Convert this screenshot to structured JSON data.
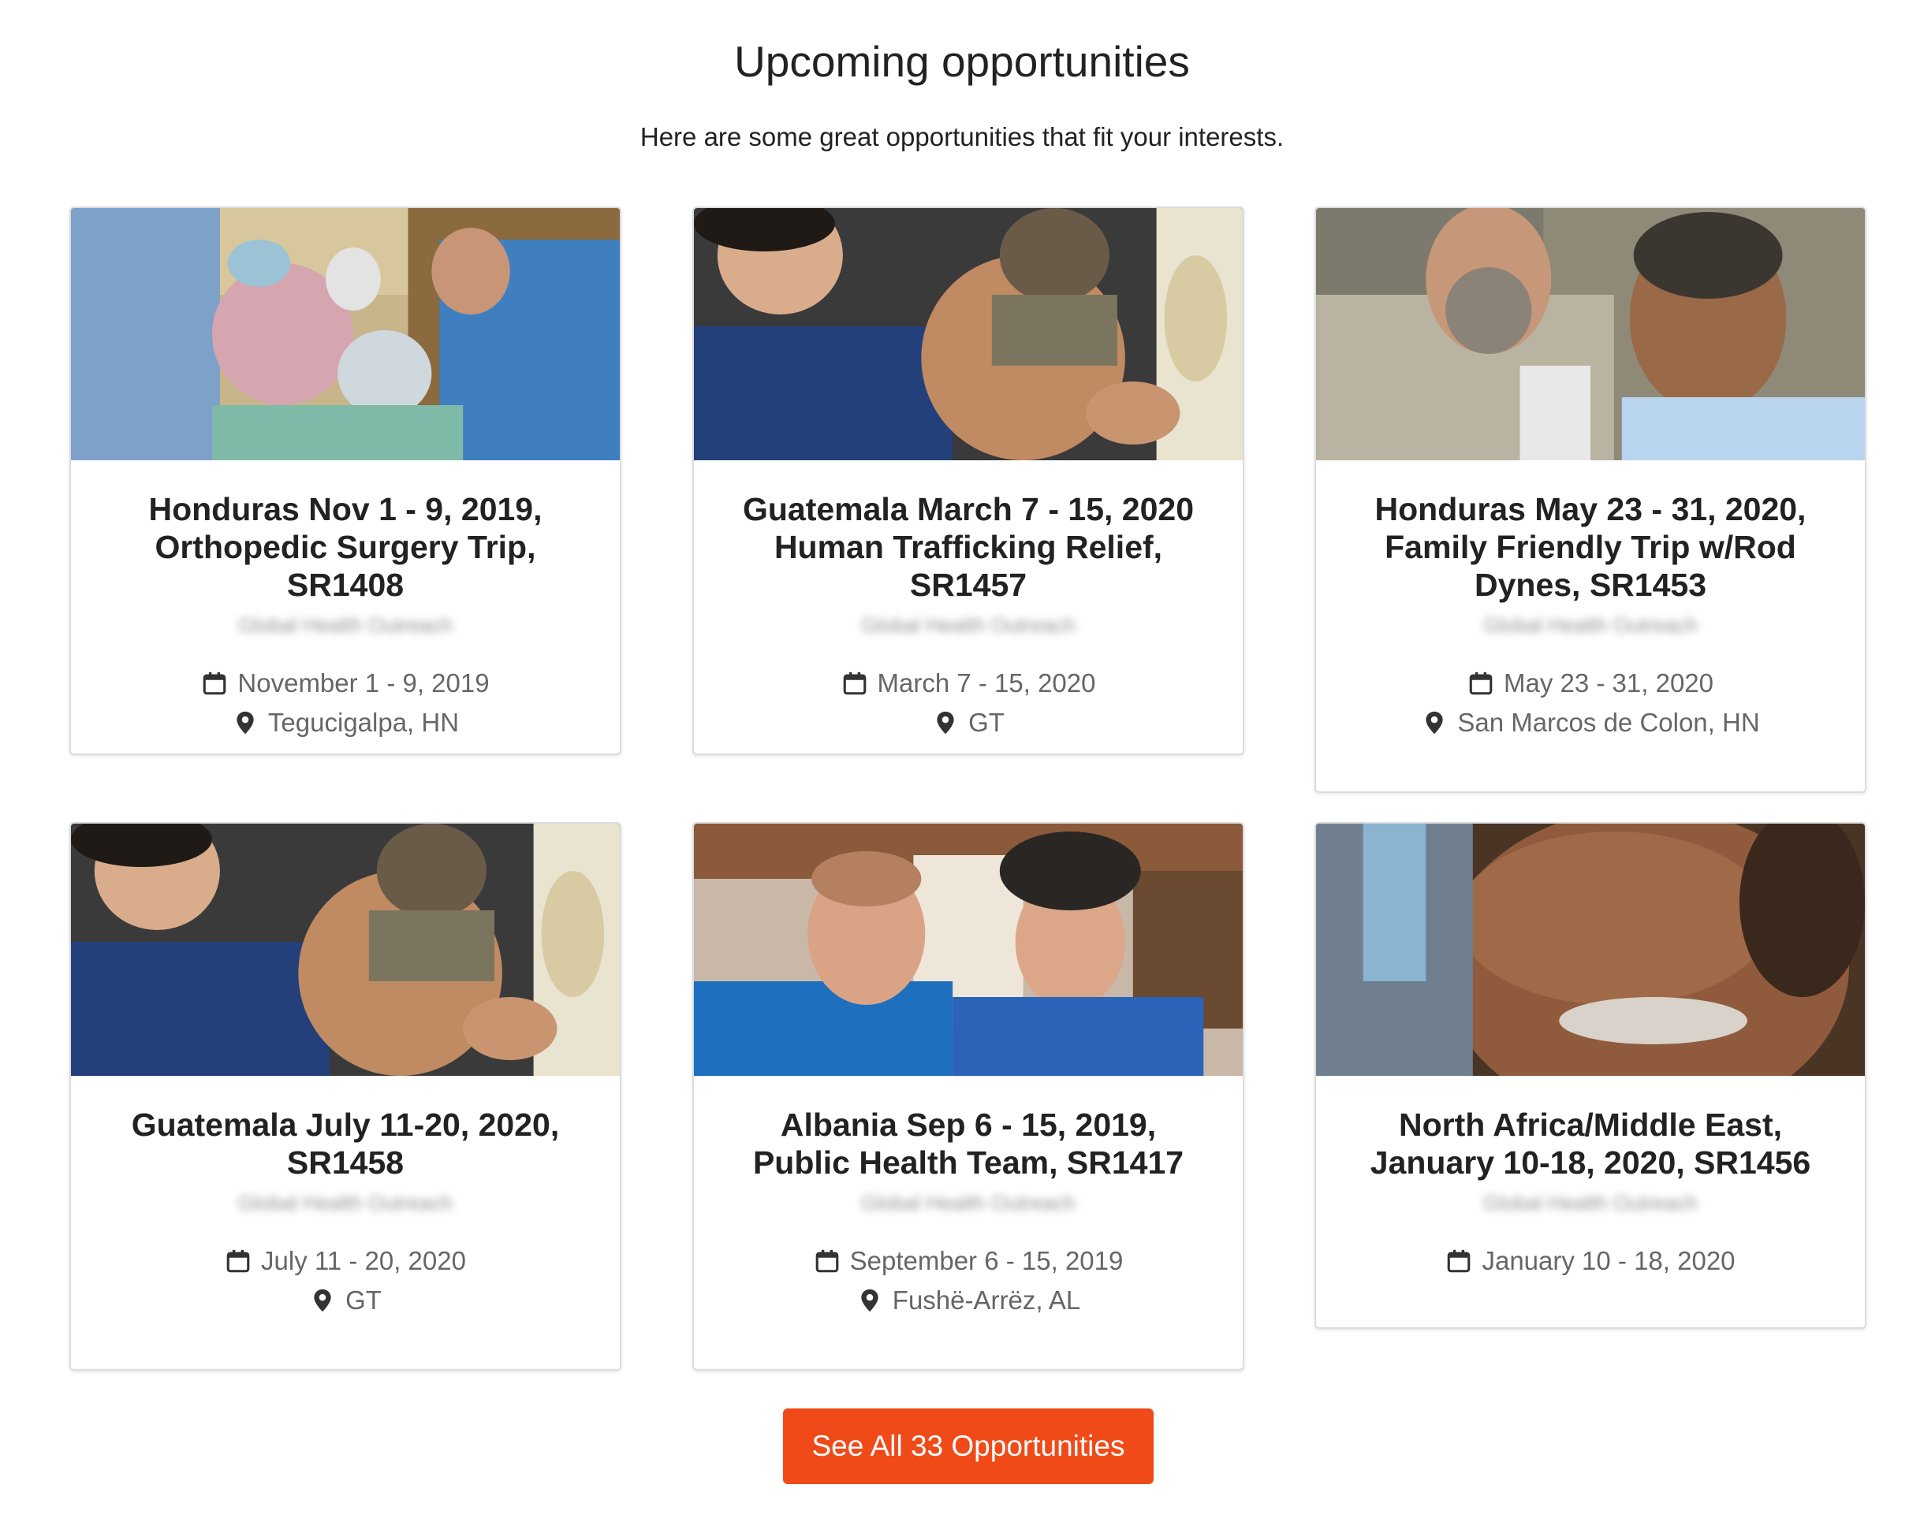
{
  "header": {
    "title": "Upcoming opportunities",
    "subtitle": "Here are some great opportunities that fit your interests."
  },
  "cards": [
    {
      "title": "Honduras Nov 1 - 9, 2019, Orthopedic Surgery Trip, SR1408",
      "organization": "Global Health Outreach",
      "date": "November 1 - 9, 2019",
      "location": "Tegucigalpa, HN",
      "image": "surgery-team-photo"
    },
    {
      "title": "Guatemala March 7 - 15, 2020 Human Trafficking Relief, SR1457",
      "organization": "Global Health Outreach",
      "date": "March 7 - 15, 2020",
      "location": "GT",
      "image": "stethoscope-child-photo"
    },
    {
      "title": "Honduras May 23 - 31, 2020, Family Friendly Trip w/Rod Dynes, SR1453",
      "organization": "Global Health Outreach",
      "date": "May 23 - 31, 2020",
      "location": "San Marcos de Colon, HN",
      "image": "doctor-elderly-woman-photo"
    },
    {
      "title": "Guatemala July 11-20, 2020, SR1458",
      "organization": "Global Health Outreach",
      "date": "July 11 - 20, 2020",
      "location": "GT",
      "image": "stethoscope-child-photo"
    },
    {
      "title": "Albania Sep 6 - 15, 2019, Public Health Team, SR1417",
      "organization": "Global Health Outreach",
      "date": "September 6 - 15, 2019",
      "location": "Fushë-Arrëz, AL",
      "image": "doctor-woman-headscarf-photo"
    },
    {
      "title": "North Africa/Middle East, January 10-18, 2020, SR1456",
      "organization": "Global Health Outreach",
      "date": "January 10 - 18, 2020",
      "location": "",
      "image": "elderly-man-closeup-photo"
    }
  ],
  "cta": {
    "label": "See All 33 Opportunities"
  },
  "colors": {
    "accent": "#f04a19",
    "meta_text": "#666666",
    "card_border": "#dcdcdc"
  },
  "icons": {
    "date": "calendar-icon",
    "location": "map-pin-icon"
  }
}
